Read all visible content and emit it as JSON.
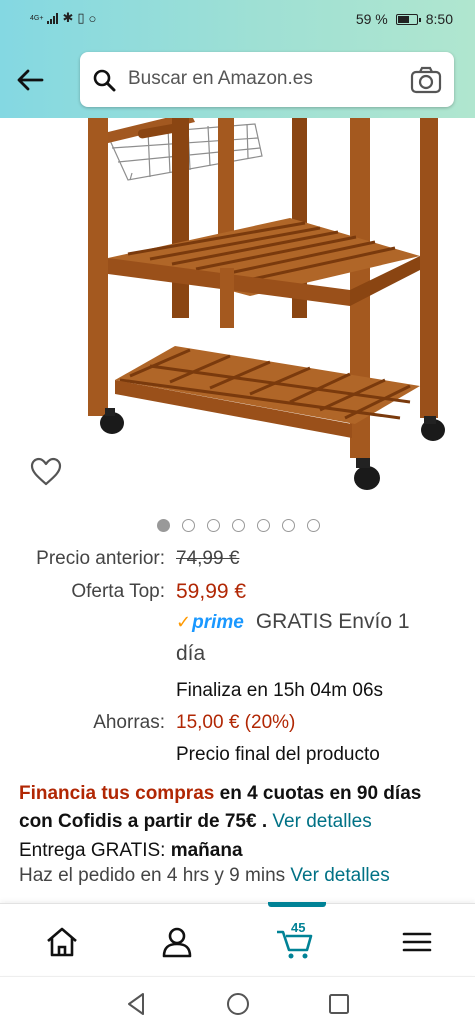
{
  "status_bar": {
    "network": "4G+",
    "battery": "59 %",
    "time": "8:50"
  },
  "search": {
    "placeholder": "Buscar en Amazon.es"
  },
  "carousel": {
    "count": 7,
    "active": 1
  },
  "price": {
    "previous_label": "Precio anterior:",
    "previous_value": "74,99 €",
    "offer_label": "Oferta Top:",
    "offer_value": "59,99 €",
    "prime": "prime",
    "shipping_line1": "GRATIS Envío 1",
    "shipping_line2": "día",
    "ends": "Finaliza en 15h 04m 06s",
    "savings_label": "Ahorras:",
    "savings_value": "15,00 € (20%)",
    "final_note": "Precio final del producto"
  },
  "financing": {
    "lead": "Financia tus compras",
    "middle": " en 4 cuotas en 90 días con Cofidis a partir de 75€",
    "sep": " . ",
    "link": "Ver detalles"
  },
  "delivery": {
    "label": "Entrega GRATIS:",
    "day": "mañana",
    "order_text": "Haz el pedido en 4 hrs y 9 mins",
    "link": "Ver detalles"
  },
  "bottom_nav": {
    "cart_count": "45",
    "items": [
      "home-icon",
      "account-icon",
      "cart-icon",
      "menu-icon"
    ]
  },
  "colors": {
    "header_gradient": [
      "#84d8e2",
      "#b0e6cf"
    ],
    "price_red": "#b12704",
    "link_teal": "#007185",
    "prime_blue": "#1a98ff",
    "accent_teal": "#008296"
  }
}
